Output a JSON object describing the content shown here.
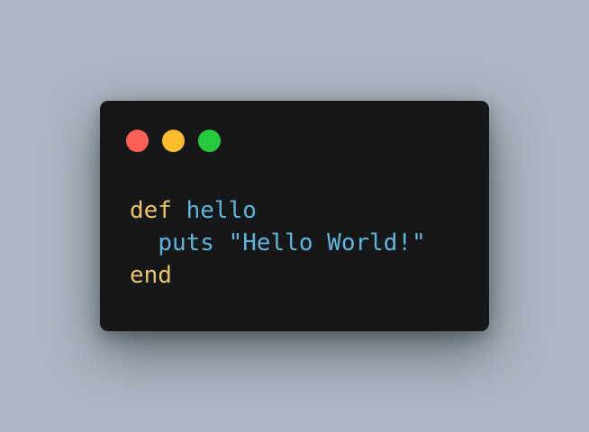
{
  "window": {
    "controls": [
      {
        "name": "close",
        "color": "#ff5f56"
      },
      {
        "name": "minimize",
        "color": "#ffbd2e"
      },
      {
        "name": "maximize",
        "color": "#27c93f"
      }
    ]
  },
  "code": {
    "lines": [
      [
        {
          "text": "def",
          "type": "keyword",
          "color": "#e9c46a"
        },
        {
          "text": " ",
          "type": "space"
        },
        {
          "text": "hello",
          "type": "identifier",
          "color": "#62b4dc"
        }
      ],
      [
        {
          "text": "  ",
          "type": "space"
        },
        {
          "text": "puts",
          "type": "identifier",
          "color": "#62b4dc"
        },
        {
          "text": " ",
          "type": "space"
        },
        {
          "text": "\"Hello World!\"",
          "type": "string",
          "color": "#62b4dc"
        }
      ],
      [
        {
          "text": "end",
          "type": "keyword",
          "color": "#e9c46a"
        }
      ]
    ]
  },
  "colors": {
    "background": "#abb8c3",
    "window": "#151718"
  }
}
